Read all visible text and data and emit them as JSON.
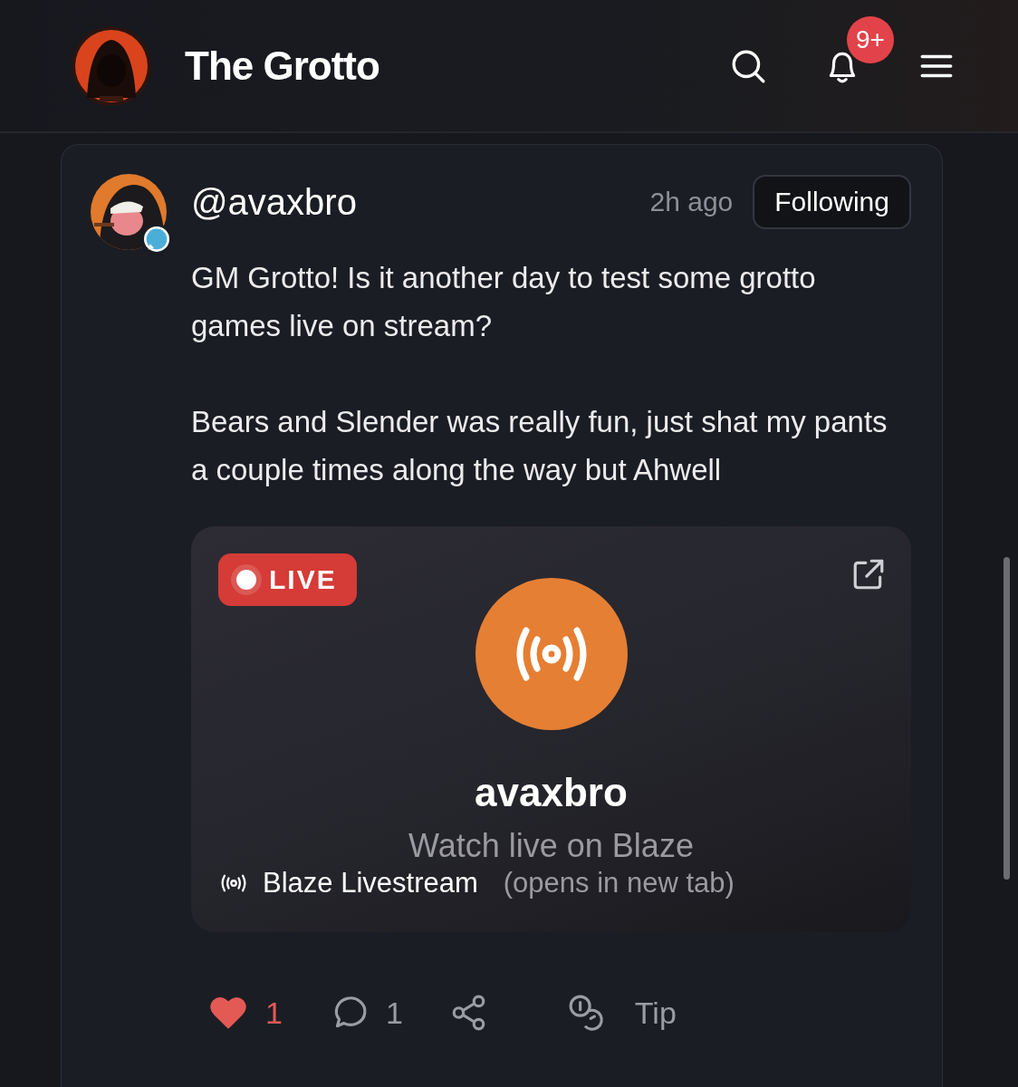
{
  "header": {
    "title": "The Grotto",
    "notification_badge": "9+"
  },
  "post": {
    "username": "@avaxbro",
    "time": "2h ago",
    "follow_button": "Following",
    "paragraphs": [
      "GM Grotto! Is it another day to test some grotto games live on stream?",
      "Bears and Slender was really fun, just shat my pants a couple times along the way but Ahwell"
    ],
    "embed": {
      "live_badge": "LIVE",
      "channel_name": "avaxbro",
      "subtitle": "Watch live on Blaze",
      "source": "Blaze Livestream",
      "source_note": "(opens in new tab)"
    },
    "actions": {
      "like_count": "1",
      "liked": true,
      "comment_count": "1",
      "tip_label": "Tip"
    }
  }
}
